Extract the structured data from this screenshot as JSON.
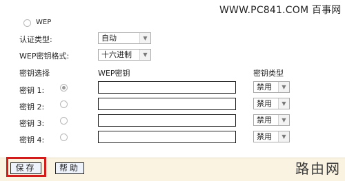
{
  "watermark_top": "WWW.PC841.COM 百事网",
  "watermark_bottom": "路由网",
  "wep_option_label": "WEP",
  "auth_type": {
    "label": "认证类型:",
    "value": "自动"
  },
  "key_format": {
    "label": "WEP密钥格式:",
    "value": "十六进制"
  },
  "columns": {
    "select": "密钥选择",
    "key": "WEP密钥",
    "type": "密钥类型"
  },
  "keys": [
    {
      "label": "密钥 1:",
      "selected": true,
      "value": "",
      "type": "禁用"
    },
    {
      "label": "密钥 2:",
      "selected": false,
      "value": "",
      "type": "禁用"
    },
    {
      "label": "密钥 3:",
      "selected": false,
      "value": "",
      "type": "禁用"
    },
    {
      "label": "密钥 4:",
      "selected": false,
      "value": "",
      "type": "禁用"
    }
  ],
  "buttons": {
    "save": "保存",
    "help": "帮助"
  }
}
